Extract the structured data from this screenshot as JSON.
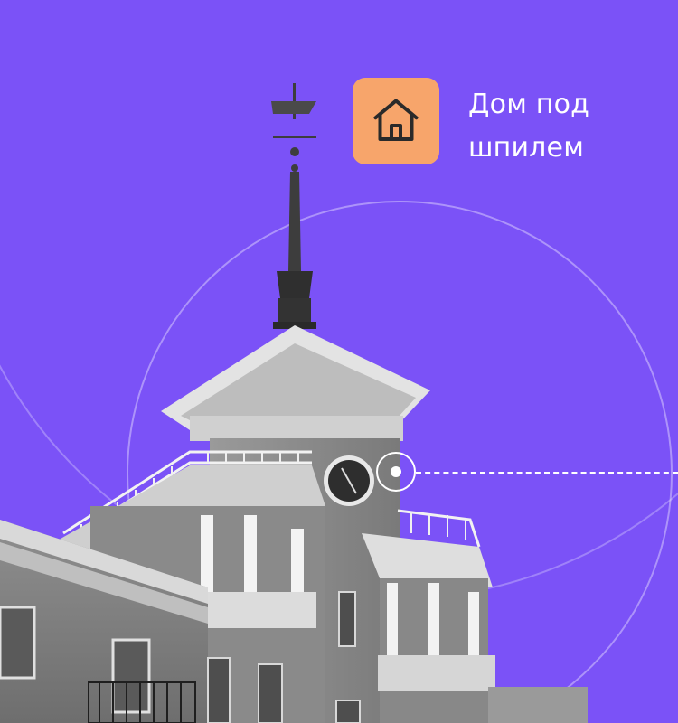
{
  "title": {
    "line1": "Дом под",
    "line2": "шпилем"
  },
  "icons": {
    "badge": "house-icon",
    "marker": "location-marker-icon"
  },
  "colors": {
    "background": "#7b52f7",
    "badge": "#f7a56b",
    "text": "#ffffff"
  }
}
